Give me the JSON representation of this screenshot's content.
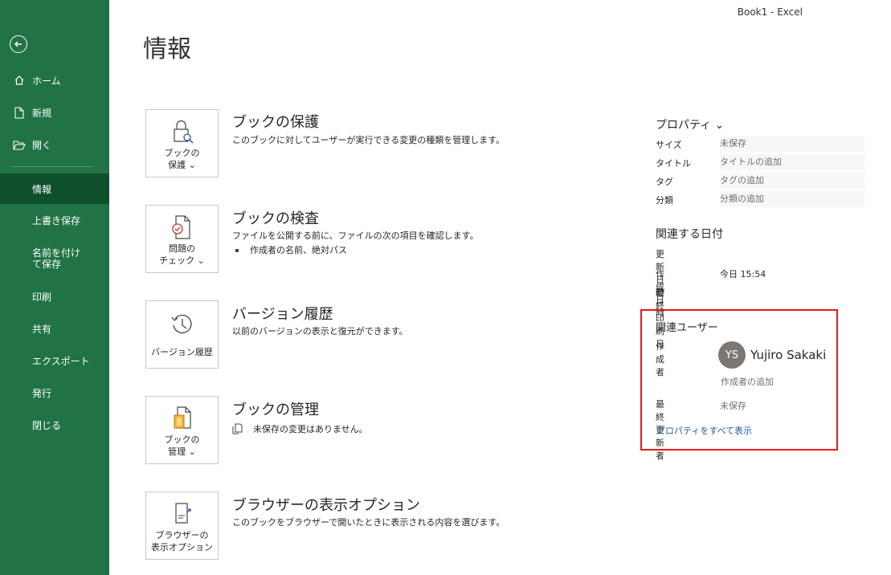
{
  "window": {
    "title": "Book1  -  Excel"
  },
  "sidebar": {
    "top_items": [
      {
        "label": "ホーム"
      },
      {
        "label": "新規"
      },
      {
        "label": "開く"
      }
    ],
    "items": [
      {
        "label": "情報"
      },
      {
        "label": "上書き保存"
      },
      {
        "label": "名前を付けて保存"
      },
      {
        "label": "印刷"
      },
      {
        "label": "共有"
      },
      {
        "label": "エクスポート"
      },
      {
        "label": "発行"
      },
      {
        "label": "閉じる"
      }
    ]
  },
  "page": {
    "title": "情報"
  },
  "sections": [
    {
      "card_line1": "ブックの",
      "card_line2": "保護 ⌄",
      "title": "ブックの保護",
      "desc": "このブックに対してユーザーが実行できる変更の種類を管理します。"
    },
    {
      "card_line1": "問題の",
      "card_line2": "チェック ⌄",
      "title": "ブックの検査",
      "desc": "ファイルを公開する前に、ファイルの次の項目を確認します。",
      "bullet": "作成者の名前、絶対パス"
    },
    {
      "card_line1": "バージョン履歴",
      "title": "バージョン履歴",
      "desc": "以前のバージョンの表示と復元ができます。"
    },
    {
      "card_line1": "ブックの",
      "card_line2": "管理 ⌄",
      "title": "ブックの管理",
      "desc": "未保存の変更はありません。"
    },
    {
      "card_line1": "ブラウザーの",
      "card_line2": "表示オプション",
      "title": "ブラウザーの表示オプション",
      "desc": "このブックをブラウザーで開いたときに表示される内容を選びます。"
    }
  ],
  "properties": {
    "heading": "プロパティ ⌄",
    "rows": [
      {
        "key": "サイズ",
        "value": "未保存"
      },
      {
        "key": "タイトル",
        "value": "タイトルの追加"
      },
      {
        "key": "タグ",
        "value": "タグの追加"
      },
      {
        "key": "分類",
        "value": "分類の追加"
      }
    ]
  },
  "dates": {
    "heading": "関連する日付",
    "rows": [
      {
        "key": "更新日時",
        "value": ""
      },
      {
        "key": "作成日時",
        "value": "今日 15:54"
      },
      {
        "key": "最終印刷日",
        "value": ""
      }
    ]
  },
  "people": {
    "heading": "関連ユーザー",
    "author_label": "作成者",
    "author_initials": "YS",
    "author_name": "Yujiro Sakaki",
    "add_author": "作成者の追加",
    "last_modified_label": "最終更新者",
    "last_modified_value": "未保存",
    "show_all_link": "プロパティをすべて表示"
  },
  "colors": {
    "accent": "#217346",
    "active": "#0e4f2c",
    "highlight": "#e31b1b",
    "link": "#2b579a"
  }
}
